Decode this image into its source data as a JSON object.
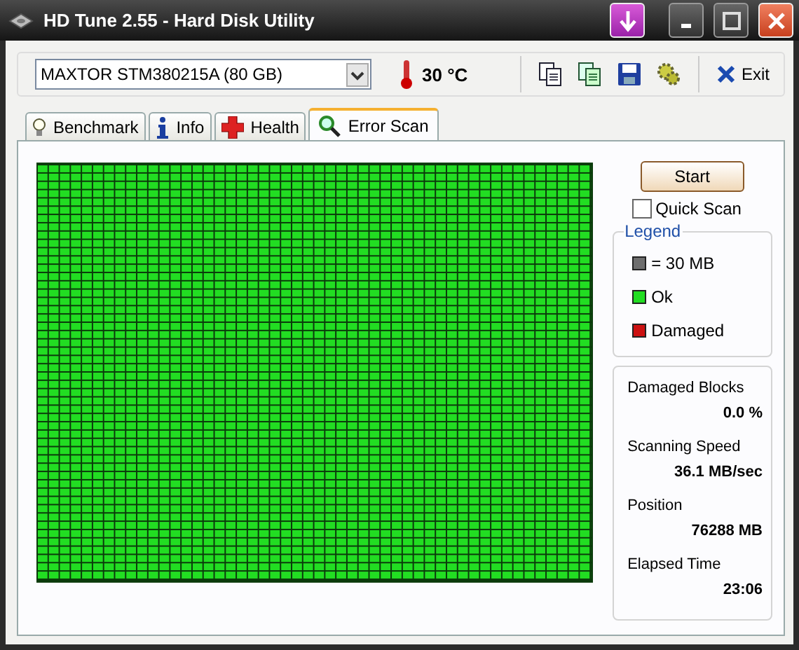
{
  "window": {
    "title": "HD Tune 2.55 - Hard Disk Utility"
  },
  "toolbar": {
    "drive": "MAXTOR STM380215A (80 GB)",
    "temperature": "30 °C",
    "exit_label": "Exit"
  },
  "tabs": [
    {
      "label": "Benchmark",
      "selected": false,
      "kind": "bulb"
    },
    {
      "label": "Info",
      "selected": false,
      "kind": "info"
    },
    {
      "label": "Health",
      "selected": false,
      "kind": "health"
    },
    {
      "label": "Error Scan",
      "selected": true,
      "kind": "scan"
    }
  ],
  "scan": {
    "start_label": "Start",
    "quick_scan": {
      "label": "Quick Scan",
      "checked": false
    }
  },
  "legend": {
    "title": "Legend",
    "items": [
      {
        "label": "= 30 MB",
        "color": "#6e6e6e"
      },
      {
        "label": "Ok",
        "color": "#22dd22"
      },
      {
        "label": "Damaged",
        "color": "#cc1111"
      }
    ]
  },
  "stats": [
    {
      "label": "Damaged Blocks",
      "value": "0.0 %"
    },
    {
      "label": "Scanning Speed",
      "value": "36.1 MB/sec"
    },
    {
      "label": "Position",
      "value": "76288 MB"
    },
    {
      "label": "Elapsed Time",
      "value": "23:06"
    }
  ]
}
